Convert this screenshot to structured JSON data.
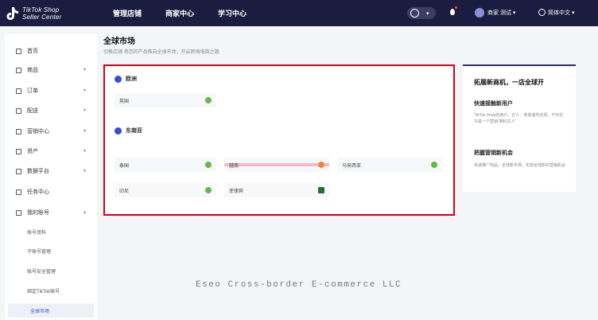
{
  "header": {
    "logo_line1": "TikTok Shop",
    "logo_line2": "Seller Center",
    "nav": [
      "管理店铺",
      "商家中心",
      "学习中心"
    ],
    "user_name": "商家 测试",
    "language": "简体中文"
  },
  "sidebar": {
    "items": [
      {
        "label": "首页",
        "chevron": false
      },
      {
        "label": "商品",
        "chevron": true
      },
      {
        "label": "订单",
        "chevron": true
      },
      {
        "label": "配送",
        "chevron": true
      },
      {
        "label": "营销中心",
        "chevron": true
      },
      {
        "label": "资产",
        "chevron": true
      },
      {
        "label": "数据平台",
        "chevron": true
      },
      {
        "label": "任务中心",
        "chevron": false
      },
      {
        "label": "我的账号",
        "chevron": true
      }
    ],
    "sub_items": [
      "账号资料",
      "子账号管理",
      "账号安全管理",
      "绑定TikTok账号",
      "全球市场"
    ],
    "active_sub": "全球市场"
  },
  "main": {
    "title": "全球市场",
    "subtitle": "切换店铺 将您的产品推向全球市场，开启跨境电商之路",
    "regions": [
      {
        "name": "欧洲",
        "markets": [
          {
            "label": "英国",
            "status": "active"
          }
        ]
      },
      {
        "name": "东南亚",
        "markets": [
          {
            "label": "泰国",
            "status": "active"
          },
          {
            "label": "越南",
            "status": "pending"
          },
          {
            "label": "马来西亚",
            "status": "active"
          },
          {
            "label": "印尼",
            "status": "active"
          },
          {
            "label": "菲律宾",
            "status": "closed"
          }
        ]
      }
    ]
  },
  "promo": {
    "title": "拓展新商机，一店全球开",
    "h1": "快速接触新用户",
    "p1": "TikTok Shop的用户，达人、商家遍布全球，不仅仅只是一个营销“网红达人”",
    "h2": "把握营销新机会",
    "p2": "快速推广商品，全球新市场，实现全球新的营销机会"
  },
  "watermark": "Eseo Cross-border E-commerce LLC",
  "colors": {
    "topbar": "#1a1d3f",
    "highlight": "#d1001c",
    "active": "#65b946",
    "pending": "#e98a3f"
  }
}
